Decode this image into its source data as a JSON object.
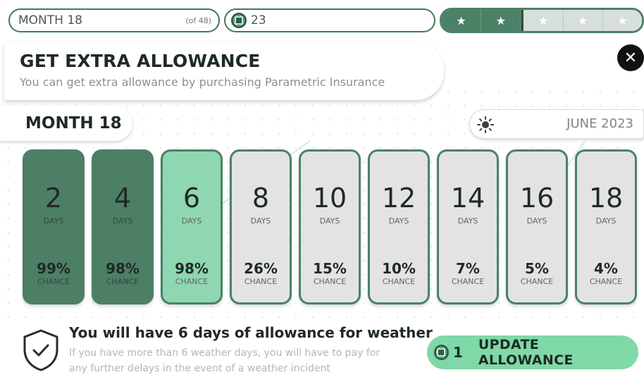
{
  "top_bar": {
    "month_label": "MONTH 18",
    "month_of": "(of 48)",
    "coins": "23",
    "stars": {
      "filled": 2,
      "total": 5,
      "icon": "star-icon"
    }
  },
  "panel": {
    "title": "GET EXTRA ALLOWANCE",
    "subtitle": "You can get extra allowance by purchasing Parametric Insurance",
    "close_icon": "close-icon",
    "month_heading": "MONTH 18",
    "date": "JUNE 2023",
    "weather_icon": "sun-icon"
  },
  "options": [
    {
      "days": "2",
      "days_label": "DAYS",
      "chance": "99%",
      "chance_label": "CHANCE",
      "state": "dark"
    },
    {
      "days": "4",
      "days_label": "DAYS",
      "chance": "98%",
      "chance_label": "CHANCE",
      "state": "dark"
    },
    {
      "days": "6",
      "days_label": "DAYS",
      "chance": "98%",
      "chance_label": "CHANCE",
      "state": "light"
    },
    {
      "days": "8",
      "days_label": "DAYS",
      "chance": "26%",
      "chance_label": "CHANCE",
      "state": "none"
    },
    {
      "days": "10",
      "days_label": "DAYS",
      "chance": "15%",
      "chance_label": "CHANCE",
      "state": "none"
    },
    {
      "days": "12",
      "days_label": "DAYS",
      "chance": "10%",
      "chance_label": "CHANCE",
      "state": "none"
    },
    {
      "days": "14",
      "days_label": "DAYS",
      "chance": "7%",
      "chance_label": "CHANCE",
      "state": "none"
    },
    {
      "days": "16",
      "days_label": "DAYS",
      "chance": "5%",
      "chance_label": "CHANCE",
      "state": "none"
    },
    {
      "days": "18",
      "days_label": "DAYS",
      "chance": "4%",
      "chance_label": "CHANCE",
      "state": "none"
    }
  ],
  "footer": {
    "summary": "You will have 6 days of allowance for weather",
    "description": "If you have more than 6 weather days, you will have to pay for any further delays in the event of a weather incident",
    "button_cost": "1",
    "button_label": "UPDATE ALLOWANCE"
  },
  "colors": {
    "accent_dark": "#4d7f66",
    "accent_light": "#8ed7b0",
    "button": "#7fd8a7",
    "unselected": "#e3e3e3"
  }
}
